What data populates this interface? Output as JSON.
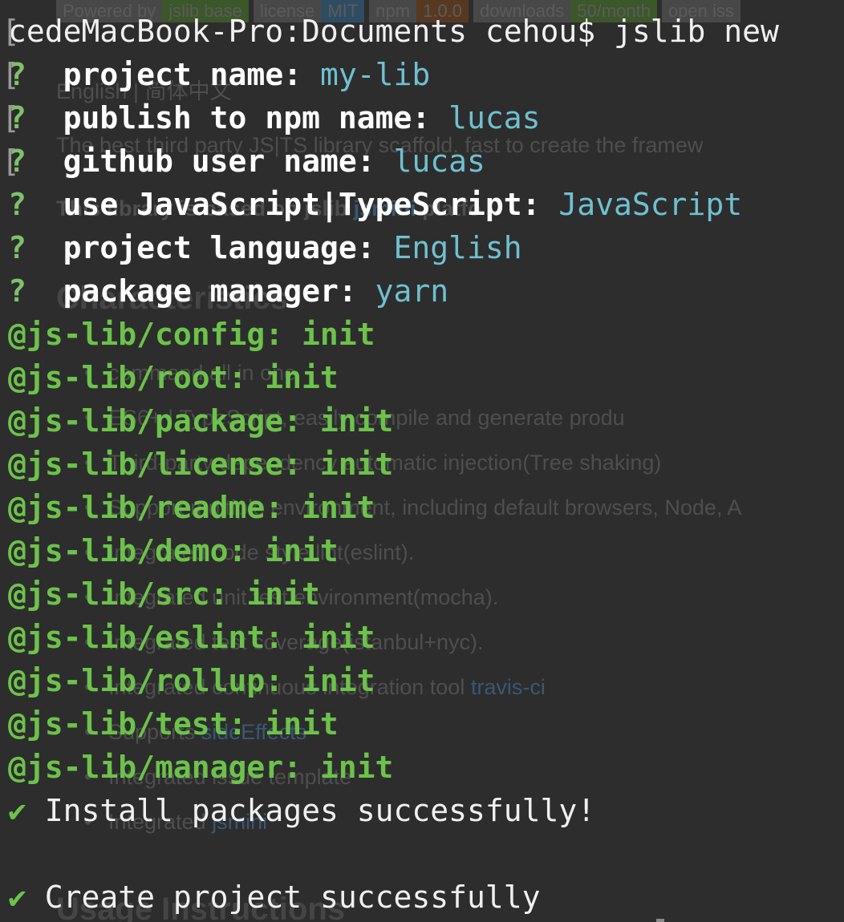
{
  "background_readme": {
    "badges": [
      {
        "key": "Powered by",
        "value": "jslib base",
        "color": "green"
      },
      {
        "key": "license",
        "value": "MIT",
        "color": "blue"
      },
      {
        "key": "npm",
        "value": "1.0.0",
        "color": "orange"
      },
      {
        "key": "downloads",
        "value": "50/month",
        "color": "green"
      },
      {
        "key": "open iss",
        "value": "",
        "color": "dark"
      }
    ],
    "lang_line": "English | 简体中文",
    "intro": "The best third party JS|TS library scaffold. fast to create the framew",
    "intro2_prefix": "This library is based on jslib",
    "intro2_link": "jsmini",
    "intro2_suffix": "platfo",
    "heading_characteristics": "Characteristics",
    "bullets": [
      "command all in one",
      "ES6+ | TypeScript, easily compile and generate produ",
      "Third-party dependency automatic injection(Tree shaking)",
      "Support multiple environment, including default browsers, Node, A",
      "Integrated code style lint(eslint).",
      "Integrated unit test environment(mocha).",
      "Integrated test coverage(istanbul+nyc).",
      "Integrated continuous integration tool",
      "Supports",
      "Integrated issue template",
      "Integrated"
    ],
    "bullet_links": {
      "travis": "travis-ci",
      "side_effects": "sideEffects",
      "jsmini": "jsmini"
    },
    "heading_usage": "Usage Instructions"
  },
  "terminal": {
    "prompt_line": "cedeMacBook-Pro:Documents cehou$ jslib new",
    "questions": [
      {
        "label": "project name:",
        "answer": "my-lib"
      },
      {
        "label": "publish to npm name:",
        "answer": "lucas"
      },
      {
        "label": "github user name:",
        "answer": "lucas"
      },
      {
        "label": "use JavaScript|TypeScript:",
        "answer": "JavaScript"
      },
      {
        "label": "project language:",
        "answer": "English"
      },
      {
        "label": "package manager:",
        "answer": "yarn"
      }
    ],
    "question_mark": "?",
    "packages": [
      "@js-lib/config: init",
      "@js-lib/root: init",
      "@js-lib/package: init",
      "@js-lib/license: init",
      "@js-lib/readme: init",
      "@js-lib/demo: init",
      "@js-lib/src: init",
      "@js-lib/eslint: init",
      "@js-lib/rollup: init",
      "@js-lib/test: init",
      "@js-lib/manager: init"
    ],
    "check_mark": "✔",
    "install_message": "Install packages successfully!",
    "create_message": "Create project successfully"
  },
  "colors": {
    "background": "#2d2d2d",
    "question_mark": "#7ec16a",
    "answer": "#6fc0cf",
    "package_line": "#6cc24a",
    "text": "#f0f0f0"
  }
}
